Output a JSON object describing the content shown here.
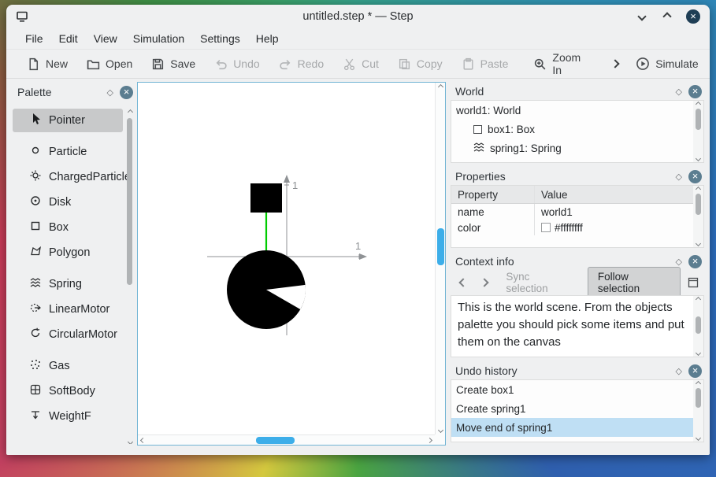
{
  "window": {
    "title": "untitled.step * — Step"
  },
  "menu": {
    "items": [
      "File",
      "Edit",
      "View",
      "Simulation",
      "Settings",
      "Help"
    ]
  },
  "toolbar": {
    "buttons": [
      {
        "label": "New",
        "icon": "new-document-icon",
        "enabled": true
      },
      {
        "label": "Open",
        "icon": "open-folder-icon",
        "enabled": true
      },
      {
        "label": "Save",
        "icon": "save-icon",
        "enabled": true
      },
      {
        "label": "Undo",
        "icon": "undo-icon",
        "enabled": false
      },
      {
        "label": "Redo",
        "icon": "redo-icon",
        "enabled": false
      },
      {
        "label": "Cut",
        "icon": "cut-icon",
        "enabled": false
      },
      {
        "label": "Copy",
        "icon": "copy-icon",
        "enabled": false
      },
      {
        "label": "Paste",
        "icon": "paste-icon",
        "enabled": false
      },
      {
        "label": "Zoom In",
        "icon": "zoom-in-icon",
        "enabled": true
      },
      {
        "label": "Simulate",
        "icon": "play-circle-icon",
        "enabled": true
      }
    ]
  },
  "palette": {
    "title": "Palette",
    "items": [
      {
        "label": "Pointer",
        "icon": "pointer-icon",
        "selected": true
      },
      {
        "label": "Particle",
        "icon": "particle-icon",
        "selected": false
      },
      {
        "label": "ChargedParticle",
        "icon": "charged-particle-icon",
        "selected": false
      },
      {
        "label": "Disk",
        "icon": "disk-icon",
        "selected": false
      },
      {
        "label": "Box",
        "icon": "box-icon",
        "selected": false
      },
      {
        "label": "Polygon",
        "icon": "polygon-icon",
        "selected": false
      },
      {
        "label": "Spring",
        "icon": "spring-icon",
        "selected": false
      },
      {
        "label": "LinearMotor",
        "icon": "linear-motor-icon",
        "selected": false
      },
      {
        "label": "CircularMotor",
        "icon": "circular-motor-icon",
        "selected": false
      },
      {
        "label": "Gas",
        "icon": "gas-icon",
        "selected": false
      },
      {
        "label": "SoftBody",
        "icon": "soft-body-icon",
        "selected": false
      },
      {
        "label": "WeightF",
        "icon": "weight-force-icon",
        "selected": false
      }
    ]
  },
  "canvas": {
    "x_axis_tick": "1",
    "y_axis_tick": "1"
  },
  "world_panel": {
    "title": "World",
    "items": [
      {
        "label": "world1: World"
      },
      {
        "label": "box1: Box",
        "icon": "box-icon"
      },
      {
        "label": "spring1: Spring",
        "icon": "spring-icon"
      }
    ]
  },
  "properties_panel": {
    "title": "Properties",
    "columns": [
      "Property",
      "Value"
    ],
    "rows": [
      {
        "property": "name",
        "value": "world1"
      },
      {
        "property": "color",
        "value": "#ffffffff",
        "swatch": "#ffffff"
      }
    ]
  },
  "context_panel": {
    "title": "Context info",
    "sync_label": "Sync selection",
    "follow_label": "Follow selection",
    "text": "This is the world scene. From the objects palette you should pick some items and put them on the canvas"
  },
  "undo_panel": {
    "title": "Undo history",
    "items": [
      {
        "label": "Create box1",
        "selected": false
      },
      {
        "label": "Create spring1",
        "selected": false
      },
      {
        "label": "Move end of spring1",
        "selected": true
      }
    ]
  },
  "colors": {
    "accent": "#3daee9",
    "selection_bg": "#bfdff4",
    "window_bg": "#eff0f1",
    "spring_green": "#00cc00"
  }
}
